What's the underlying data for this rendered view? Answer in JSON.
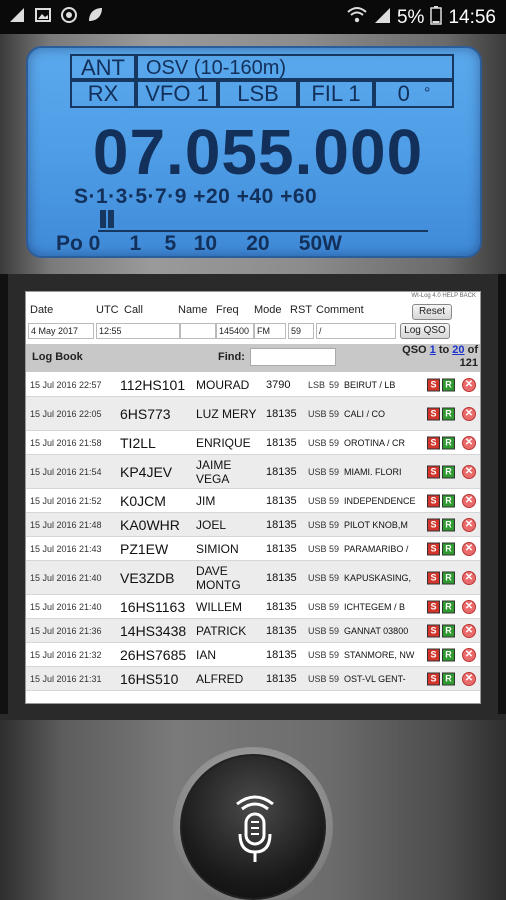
{
  "status_bar": {
    "battery": "5%",
    "time": "14:56",
    "icons": [
      "signal-strength-icon",
      "image-icon",
      "camera-lens-icon",
      "leaf-icon",
      "wifi-icon",
      "cell-signal-icon",
      "battery-icon"
    ]
  },
  "radio": {
    "ant_label": "ANT",
    "band_label": "OSV (10-160m)",
    "rx_label": "RX",
    "vfo_label": "VFO 1",
    "mode_label": "LSB",
    "fil_label": "FIL 1",
    "offset_value": "0",
    "degree_symbol": "°",
    "frequency": "07.055.000",
    "smeter_scale": "S·1·3·5·7·9 +20 +40 +60",
    "power_scale": "Po 0     1    5   10     20     50W",
    "smeter_level_segments": 2,
    "lcd_color": "#4f9de6"
  },
  "log": {
    "version_text": "Wt-Log 4.0  HELP  BACK",
    "headers": {
      "date": "Date",
      "utc": "UTC",
      "call": "Call",
      "name": "Name",
      "freq": "Freq",
      "mode": "Mode",
      "rst": "RST",
      "comment": "Comment"
    },
    "inputs": {
      "date": "4 May 2017",
      "utc": "12:55",
      "call": "",
      "name": "",
      "freq": "145400",
      "mode": "FM",
      "rst": "59",
      "comment": "/"
    },
    "reset_label": "Reset",
    "log_qso_label": "Log QSO",
    "logbook_title": "Log Book",
    "find_label": "Find:",
    "qso_prefix": "QSO",
    "qso_from": "1",
    "qso_to_word": "to",
    "qso_to": "20",
    "qso_of": "of",
    "qso_total": "121",
    "s_label": "S",
    "r_label": "R",
    "x_label": "✕",
    "rows": [
      {
        "datetime": "15 Jul 2016 22:57",
        "call": "112HS101",
        "name": "MOURAD",
        "freq": "3790",
        "mode": "LSB",
        "rst": "59",
        "comment": "BEIRUT / LB"
      },
      {
        "datetime": "15 Jul 2016 22:05",
        "call": "6HS773",
        "name": "LUZ MERY",
        "freq": "18135",
        "mode": "USB",
        "rst": "59",
        "comment": "CALI / CO"
      },
      {
        "datetime": "15 Jul 2016 21:58",
        "call": "TI2LL",
        "name": "ENRIQUE",
        "freq": "18135",
        "mode": "USB",
        "rst": "59",
        "comment": "OROTINA / CR"
      },
      {
        "datetime": "15 Jul 2016 21:54",
        "call": "KP4JEV",
        "name": "JAIME VEGA",
        "freq": "18135",
        "mode": "USB",
        "rst": "59",
        "comment": "MIAMI. FLORI"
      },
      {
        "datetime": "15 Jul 2016 21:52",
        "call": "K0JCM",
        "name": "JIM",
        "freq": "18135",
        "mode": "USB",
        "rst": "59",
        "comment": "INDEPENDENCE"
      },
      {
        "datetime": "15 Jul 2016 21:48",
        "call": "KA0WHR",
        "name": "JOEL",
        "freq": "18135",
        "mode": "USB",
        "rst": "59",
        "comment": "PILOT KNOB,M"
      },
      {
        "datetime": "15 Jul 2016 21:43",
        "call": "PZ1EW",
        "name": "SIMION",
        "freq": "18135",
        "mode": "USB",
        "rst": "59",
        "comment": "PARAMARIBO /"
      },
      {
        "datetime": "15 Jul 2016 21:40",
        "call": "VE3ZDB",
        "name": "DAVE MONTG",
        "freq": "18135",
        "mode": "USB",
        "rst": "59",
        "comment": "KAPUSKASING,"
      },
      {
        "datetime": "15 Jul 2016 21:40",
        "call": "16HS1163",
        "name": "WILLEM",
        "freq": "18135",
        "mode": "USB",
        "rst": "59",
        "comment": "ICHTEGEM / B"
      },
      {
        "datetime": "15 Jul 2016 21:36",
        "call": "14HS3438",
        "name": "PATRICK",
        "freq": "18135",
        "mode": "USB",
        "rst": "59",
        "comment": "GANNAT 03800"
      },
      {
        "datetime": "15 Jul 2016 21:32",
        "call": "26HS7685",
        "name": "IAN",
        "freq": "18135",
        "mode": "USB",
        "rst": "59",
        "comment": "STANMORE, NW"
      },
      {
        "datetime": "15 Jul 2016 21:31",
        "call": "16HS510",
        "name": "ALFRED",
        "freq": "18135",
        "mode": "USB",
        "rst": "59",
        "comment": "OST-VL GENT-"
      }
    ]
  },
  "ptt": {
    "icon": "microphone-icon"
  }
}
